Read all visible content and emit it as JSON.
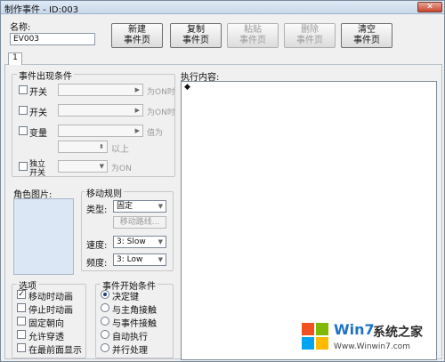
{
  "window": {
    "title": "制作事件 - ID:003",
    "close": "✕"
  },
  "name": {
    "label": "名称:",
    "value": "EV003"
  },
  "toolbar": {
    "new": [
      "新建",
      "事件页"
    ],
    "copy": [
      "复制",
      "事件页"
    ],
    "paste": [
      "粘贴",
      "事件页"
    ],
    "delete": [
      "删除",
      "事件页"
    ],
    "clear": [
      "清空",
      "事件页"
    ]
  },
  "tabs": [
    "1"
  ],
  "conditions": {
    "title": "事件出现条件",
    "switch1": {
      "label": "开关",
      "suffix": "为ON时"
    },
    "switch2": {
      "label": "开关",
      "suffix": "为ON时"
    },
    "variable": {
      "label": "变量",
      "suffix": "值为",
      "suffix2": "以上"
    },
    "self_switch": {
      "label1": "独立",
      "label2": "开关",
      "suffix": "为ON"
    }
  },
  "graphic": {
    "label": "角色图片:"
  },
  "movement": {
    "title": "移动规则",
    "type_label": "类型:",
    "type_value": "固定",
    "route_button": "移动路线...",
    "speed_label": "速度:",
    "speed_value": "3: Slow",
    "freq_label": "频度:",
    "freq_value": "3: Low"
  },
  "options": {
    "title": "选项",
    "items": [
      {
        "label": "移动时动画",
        "checked": true
      },
      {
        "label": "停止时动画",
        "checked": false
      },
      {
        "label": "固定朝向",
        "checked": false
      },
      {
        "label": "允许穿透",
        "checked": false
      },
      {
        "label": "在最前面显示",
        "checked": false
      }
    ]
  },
  "trigger": {
    "title": "事件开始条件",
    "items": [
      {
        "label": "决定键",
        "selected": true
      },
      {
        "label": "与主角接触",
        "selected": false
      },
      {
        "label": "与事件接触",
        "selected": false
      },
      {
        "label": "自动执行",
        "selected": false
      },
      {
        "label": "并行处理",
        "selected": false
      }
    ]
  },
  "execution": {
    "label": "执行内容:",
    "bullet": "◆"
  },
  "watermark": {
    "brand1": "Win7",
    "brand2": "系统之家",
    "url": "Www.Winwin7.com"
  },
  "check_mark": "✓"
}
